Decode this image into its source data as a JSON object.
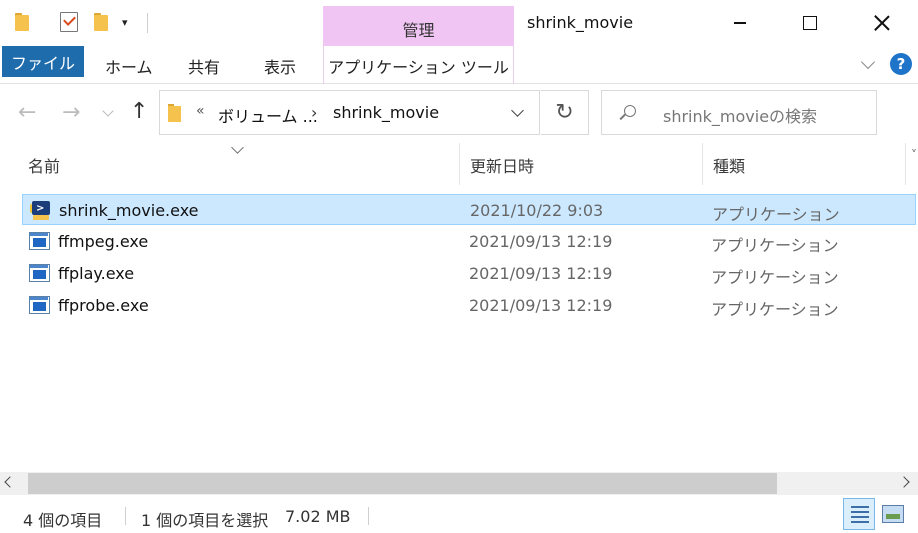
{
  "window": {
    "title": "shrink_movie",
    "contextual_group_label": "管理",
    "contextual_group_color": "#f0c5f3"
  },
  "quick_access": {
    "dropdown_glyph": "▾"
  },
  "ribbon": {
    "file_tab": "ファイル",
    "file_tab_color": "#1f6cad",
    "tabs": [
      "ホーム",
      "共有",
      "表示",
      "アプリケーション ツール"
    ],
    "help_label": "?"
  },
  "nav": {
    "back_glyph": "←",
    "forward_glyph": "→",
    "up_glyph": "↑",
    "refresh_glyph": "↻"
  },
  "address": {
    "overflow": "«",
    "crumbs": [
      "ボリューム ...",
      "shrink_movie"
    ],
    "separator": "›"
  },
  "search": {
    "placeholder": "shrink_movieの検索"
  },
  "columns": {
    "name": "名前",
    "date": "更新日時",
    "type": "種類",
    "more": "˅"
  },
  "files": [
    {
      "name": "shrink_movie.exe",
      "date": "2021/10/22 9:03",
      "type": "アプリケーション",
      "selected": true,
      "icon": "app-console-icon"
    },
    {
      "name": "ffmpeg.exe",
      "date": "2021/09/13 12:19",
      "type": "アプリケーション",
      "selected": false,
      "icon": "exe-window-icon"
    },
    {
      "name": "ffplay.exe",
      "date": "2021/09/13 12:19",
      "type": "アプリケーション",
      "selected": false,
      "icon": "exe-window-icon"
    },
    {
      "name": "ffprobe.exe",
      "date": "2021/09/13 12:19",
      "type": "アプリケーション",
      "selected": false,
      "icon": "exe-window-icon"
    }
  ],
  "status": {
    "item_count": "4 個の項目",
    "selected_count": "1 個の項目を選択",
    "selected_size": "7.02 MB"
  },
  "colors": {
    "selection_bg": "#cce8ff",
    "selection_border": "#99d1ff",
    "accent": "#1e74c9"
  }
}
